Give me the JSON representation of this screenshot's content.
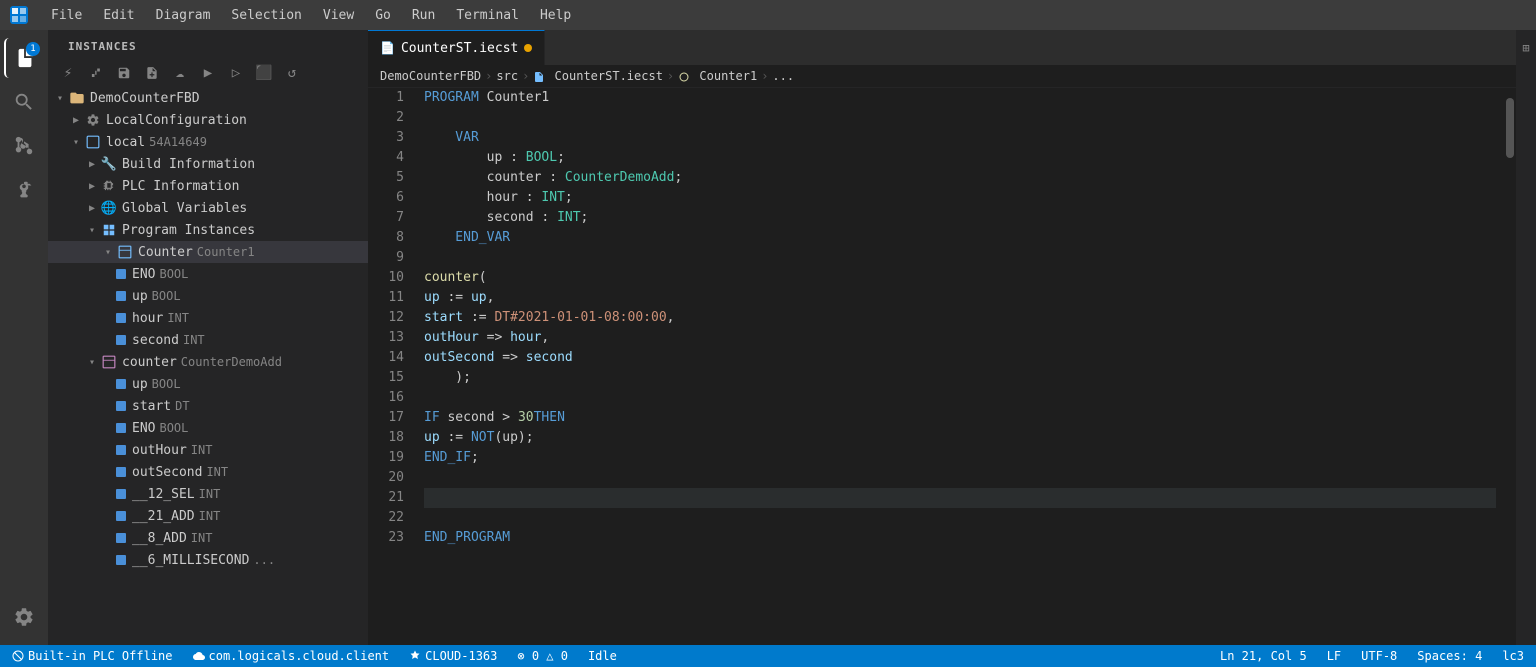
{
  "titlebar": {
    "menu_items": [
      "File",
      "Edit",
      "Diagram",
      "Selection",
      "View",
      "Go",
      "Run",
      "Terminal",
      "Help"
    ]
  },
  "sidebar": {
    "header": "INSTANCES",
    "toolbar_icons": [
      "plug-icon",
      "branch-icon",
      "save-icon",
      "new-file-icon",
      "cloud-icon",
      "play-icon",
      "play-outline-icon",
      "stop-icon",
      "refresh-icon"
    ],
    "tree": [
      {
        "id": "democounterfbd",
        "label": "DemoCounterFBD",
        "indent": 0,
        "arrow": "▶",
        "icon": "folder",
        "expanded": true
      },
      {
        "id": "localconfig",
        "label": "LocalConfiguration",
        "indent": 1,
        "arrow": "▶",
        "icon": "gear",
        "expanded": false
      },
      {
        "id": "local",
        "label": "local",
        "indent": 1,
        "arrow": "▶",
        "icon": "box",
        "secondary": "54A14649",
        "expanded": true
      },
      {
        "id": "buildinfo",
        "label": "Build Information",
        "indent": 2,
        "arrow": "▶",
        "icon": "wrench",
        "expanded": false
      },
      {
        "id": "plcinfo",
        "label": "PLC Information",
        "indent": 2,
        "arrow": "▶",
        "icon": "cpu",
        "expanded": false
      },
      {
        "id": "globalvars",
        "label": "Global Variables",
        "indent": 2,
        "arrow": "▶",
        "icon": "globe",
        "expanded": false
      },
      {
        "id": "programinst",
        "label": "Program Instances",
        "indent": 2,
        "arrow": "▶",
        "icon": "blocks",
        "expanded": true
      },
      {
        "id": "counter",
        "label": "Counter",
        "indent": 3,
        "arrow": "▶",
        "icon": "block",
        "secondary": "Counter1",
        "expanded": true,
        "active": true
      },
      {
        "id": "eno",
        "label": "ENO",
        "indent": 4,
        "type": "BOOL",
        "square": true
      },
      {
        "id": "up",
        "label": "up",
        "indent": 4,
        "type": "BOOL",
        "square": true
      },
      {
        "id": "hour",
        "label": "hour",
        "indent": 4,
        "type": "INT",
        "square": true
      },
      {
        "id": "second",
        "label": "second",
        "indent": 4,
        "type": "INT",
        "square": true
      },
      {
        "id": "counter2",
        "label": "counter",
        "indent": 3,
        "arrow": "▼",
        "icon": "block2",
        "secondary": "CounterDemoAdd",
        "expanded": true
      },
      {
        "id": "cup",
        "label": "up",
        "indent": 4,
        "type": "BOOL",
        "square": true
      },
      {
        "id": "cstart",
        "label": "start",
        "indent": 4,
        "type": "DT",
        "square": true
      },
      {
        "id": "ceno",
        "label": "ENO",
        "indent": 4,
        "type": "BOOL",
        "square": true
      },
      {
        "id": "couthour",
        "label": "outHour",
        "indent": 4,
        "type": "INT",
        "square": true
      },
      {
        "id": "coutsecond",
        "label": "outSecond",
        "indent": 4,
        "type": "INT",
        "square": true
      },
      {
        "id": "c12sel",
        "label": "__12_SEL",
        "indent": 4,
        "type": "INT",
        "square": true
      },
      {
        "id": "c21add",
        "label": "__21_ADD",
        "indent": 4,
        "type": "INT",
        "square": true
      },
      {
        "id": "c8add",
        "label": "__8_ADD",
        "indent": 4,
        "type": "INT",
        "square": true
      },
      {
        "id": "c6ms",
        "label": "__6_MILLISECOND",
        "indent": 4,
        "type": "",
        "square": true,
        "ellipsis": true
      }
    ]
  },
  "editor": {
    "tab": {
      "label": "CounterST.iecst",
      "modified": true,
      "icon": "file-icon"
    },
    "breadcrumb": [
      "DemoCounterFBD",
      "src",
      "CounterST.iecst",
      "Counter1",
      "..."
    ],
    "lines": [
      {
        "num": 1,
        "tokens": [
          {
            "t": "PROGRAM",
            "c": "kw"
          },
          {
            "t": " Counter1",
            "c": ""
          }
        ]
      },
      {
        "num": 2,
        "tokens": []
      },
      {
        "num": 3,
        "tokens": [
          {
            "t": "    VAR",
            "c": "kw"
          }
        ]
      },
      {
        "num": 4,
        "tokens": [
          {
            "t": "        up : ",
            "c": ""
          },
          {
            "t": "BOOL",
            "c": "type"
          },
          {
            "t": ";",
            "c": ""
          }
        ]
      },
      {
        "num": 5,
        "tokens": [
          {
            "t": "        counter : ",
            "c": ""
          },
          {
            "t": "CounterDemoAdd",
            "c": "type"
          },
          {
            "t": ";",
            "c": ""
          }
        ]
      },
      {
        "num": 6,
        "tokens": [
          {
            "t": "        hour : ",
            "c": ""
          },
          {
            "t": "INT",
            "c": "type"
          },
          {
            "t": ";",
            "c": ""
          }
        ]
      },
      {
        "num": 7,
        "tokens": [
          {
            "t": "        second : ",
            "c": ""
          },
          {
            "t": "INT",
            "c": "type"
          },
          {
            "t": ";",
            "c": ""
          }
        ]
      },
      {
        "num": 8,
        "tokens": [
          {
            "t": "    END_VAR",
            "c": "kw"
          }
        ]
      },
      {
        "num": 9,
        "tokens": []
      },
      {
        "num": 10,
        "tokens": [
          {
            "t": "    ",
            "c": ""
          },
          {
            "t": "counter",
            "c": "fn"
          },
          {
            "t": "(",
            "c": ""
          }
        ]
      },
      {
        "num": 11,
        "tokens": [
          {
            "t": "        ",
            "c": ""
          },
          {
            "t": "up",
            "c": "var"
          },
          {
            "t": " := ",
            "c": ""
          },
          {
            "t": "up",
            "c": "var"
          },
          {
            "t": ",",
            "c": ""
          }
        ]
      },
      {
        "num": 12,
        "tokens": [
          {
            "t": "        ",
            "c": ""
          },
          {
            "t": "start",
            "c": "var"
          },
          {
            "t": " := ",
            "c": ""
          },
          {
            "t": "DT#2021-01-01-08:00:00",
            "c": "str"
          },
          {
            "t": ",",
            "c": ""
          }
        ]
      },
      {
        "num": 13,
        "tokens": [
          {
            "t": "        ",
            "c": ""
          },
          {
            "t": "outHour",
            "c": "var"
          },
          {
            "t": " => ",
            "c": ""
          },
          {
            "t": "hour",
            "c": "var"
          },
          {
            "t": ",",
            "c": ""
          }
        ]
      },
      {
        "num": 14,
        "tokens": [
          {
            "t": "        ",
            "c": ""
          },
          {
            "t": "outSecond",
            "c": "var"
          },
          {
            "t": " => ",
            "c": ""
          },
          {
            "t": "second",
            "c": "var"
          }
        ]
      },
      {
        "num": 15,
        "tokens": [
          {
            "t": "    );",
            "c": ""
          }
        ]
      },
      {
        "num": 16,
        "tokens": []
      },
      {
        "num": 17,
        "tokens": [
          {
            "t": "    ",
            "c": ""
          },
          {
            "t": "IF",
            "c": "kw"
          },
          {
            "t": " second > ",
            "c": ""
          },
          {
            "t": "30",
            "c": "num"
          },
          {
            "t": " ",
            "c": ""
          },
          {
            "t": "THEN",
            "c": "kw"
          }
        ]
      },
      {
        "num": 18,
        "tokens": [
          {
            "t": "        ",
            "c": ""
          },
          {
            "t": "up",
            "c": "var"
          },
          {
            "t": " := ",
            "c": ""
          },
          {
            "t": "NOT",
            "c": "kw"
          },
          {
            "t": "(up);",
            "c": ""
          }
        ]
      },
      {
        "num": 19,
        "tokens": [
          {
            "t": "    ",
            "c": ""
          },
          {
            "t": "END_IF",
            "c": "kw"
          },
          {
            "t": ";",
            "c": ""
          }
        ]
      },
      {
        "num": 20,
        "tokens": []
      },
      {
        "num": 21,
        "tokens": [],
        "highlighted": true
      },
      {
        "num": 22,
        "tokens": []
      },
      {
        "num": 23,
        "tokens": [
          {
            "t": "END_PROGRAM",
            "c": "kw"
          }
        ]
      }
    ]
  },
  "statusbar": {
    "left": [
      {
        "id": "plc-offline",
        "text": "Built-in PLC Offline"
      },
      {
        "id": "cloud-client",
        "text": "com.logicals.cloud.client"
      },
      {
        "id": "cloud-id",
        "text": "CLOUD-1363"
      },
      {
        "id": "errors",
        "text": "⊗ 0 △ 0"
      },
      {
        "id": "idle",
        "text": "Idle"
      }
    ],
    "right": [
      {
        "id": "position",
        "text": "Ln 21, Col 5"
      },
      {
        "id": "eol",
        "text": "LF"
      },
      {
        "id": "encoding",
        "text": "UTF-8"
      },
      {
        "id": "spaces",
        "text": "Spaces: 4"
      },
      {
        "id": "language",
        "text": "lc3"
      }
    ]
  }
}
